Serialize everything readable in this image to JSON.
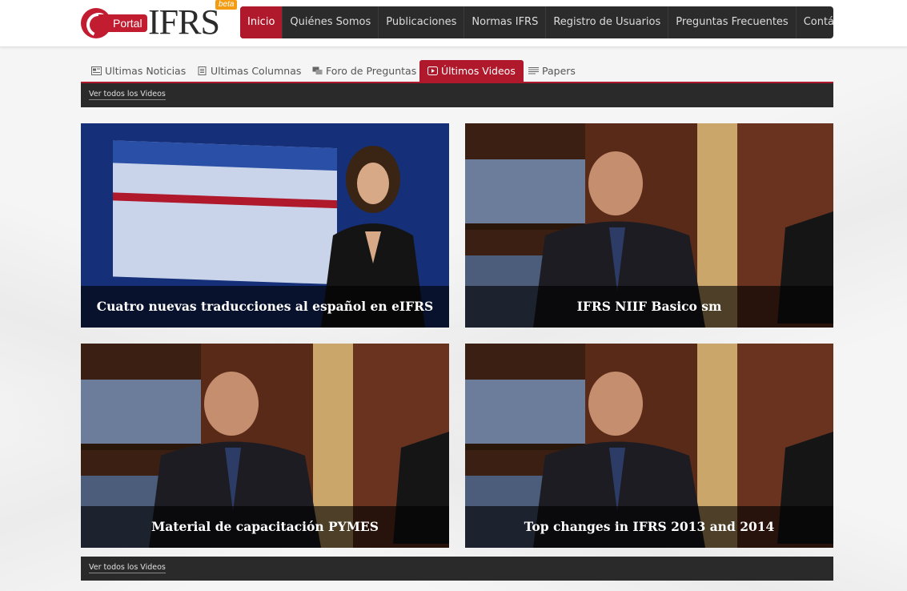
{
  "logo": {
    "portal": "Portal",
    "ifrs": "IFRS",
    "beta": "beta"
  },
  "mainnav": [
    "Inicio",
    "Quiénes Somos",
    "Publicaciones",
    "Normas IFRS",
    "Registro de Usuarios",
    "Preguntas Frecuentes",
    "Contáctenos"
  ],
  "tabs": [
    "Ultimas Noticias",
    "Ultimas Columnas",
    "Foro de Preguntas",
    "Últimos Videos",
    "Papers"
  ],
  "top_bar": {
    "link": "Ver todos los Videos"
  },
  "bottom_bar": {
    "link": "Ver todos los Videos"
  },
  "videos": [
    {
      "title": "Cuatro nuevas traducciones al español en eIFRS"
    },
    {
      "title": "IFRS NIIF Basico sm"
    },
    {
      "title": "Material de capacitación PYMES"
    },
    {
      "title": "Top changes in IFRS 2013 and 2014"
    }
  ],
  "colors": {
    "brand_red": "#b0182b",
    "nav_dark": "#2b2b2b"
  }
}
